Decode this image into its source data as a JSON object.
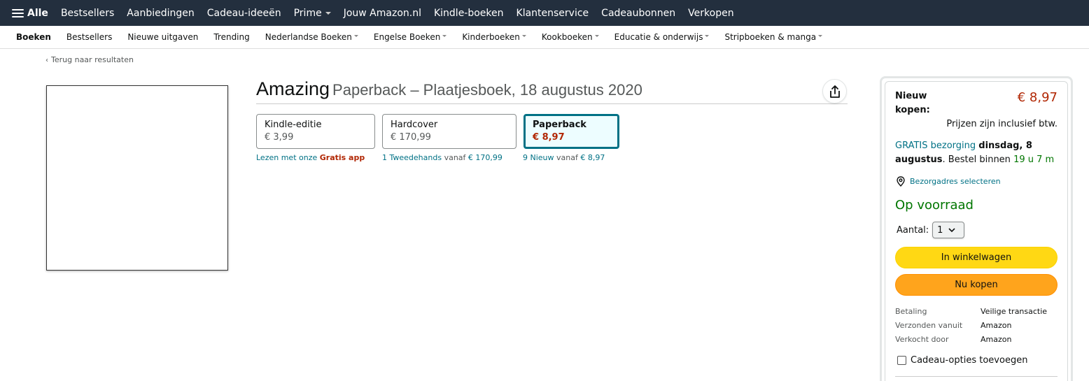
{
  "topnav": {
    "all_label": "Alle",
    "items": [
      "Bestsellers",
      "Aanbiedingen",
      "Cadeau-ideeën",
      "Prime",
      "Jouw Amazon.nl",
      "Kindle-boeken",
      "Klantenservice",
      "Cadeaubonnen",
      "Verkopen"
    ]
  },
  "subnav": {
    "items": [
      "Boeken",
      "Bestsellers",
      "Nieuwe uitgaven",
      "Trending",
      "Nederlandse Boeken",
      "Engelse Boeken",
      "Kinderboeken",
      "Kookboeken",
      "Educatie & onderwijs",
      "Stripboeken & manga"
    ]
  },
  "back_link": "Terug naar resultaten",
  "product": {
    "title": "Amazing",
    "subtitle": "Paperback – Plaatjesboek, 18 augustus 2020"
  },
  "formats": [
    {
      "name": "Kindle-editie",
      "price": "€ 3,99",
      "meta_a": "Lezen met onze",
      "meta_b": "Gratis app"
    },
    {
      "name": "Hardcover",
      "price": "€ 170,99",
      "meta_a": "1 Tweedehands",
      "meta_mid": "vanaf",
      "meta_b": "€ 170,99"
    },
    {
      "name": "Paperback",
      "price": "€ 8,97",
      "meta_a": "9 Nieuw",
      "meta_mid": "vanaf",
      "meta_b": "€ 8,97"
    }
  ],
  "buybox": {
    "new_label_1": "Nieuw",
    "new_label_2": "kopen:",
    "price": "€ 8,97",
    "vat_note": "Prijzen zijn inclusief btw.",
    "delivery_free": "GRATIS bezorging",
    "delivery_day_1": "dinsdag, 8",
    "delivery_day_2": "augustus",
    "order_within": ". Bestel binnen",
    "countdown": "19 u 7 m",
    "address_link": "Bezorgadres selecteren",
    "stock": "Op voorraad",
    "qty_label": "Aantal:",
    "qty_value": "1",
    "cart_button": "In winkelwagen",
    "buy_button": "Nu kopen",
    "payment_label": "Betaling",
    "payment_value": "Veilige transactie",
    "shipped_label": "Verzonden vanuit",
    "shipped_value": "Amazon",
    "sold_label": "Verkocht door",
    "sold_value": "Amazon",
    "gift_label": "Cadeau-opties toevoegen"
  },
  "colors": {
    "nav_bg": "#232f3e",
    "price_red": "#b12704",
    "link_teal": "#007185",
    "stock_green": "#007600",
    "cart_yellow": "#ffd814",
    "buy_orange": "#ffa41c"
  }
}
